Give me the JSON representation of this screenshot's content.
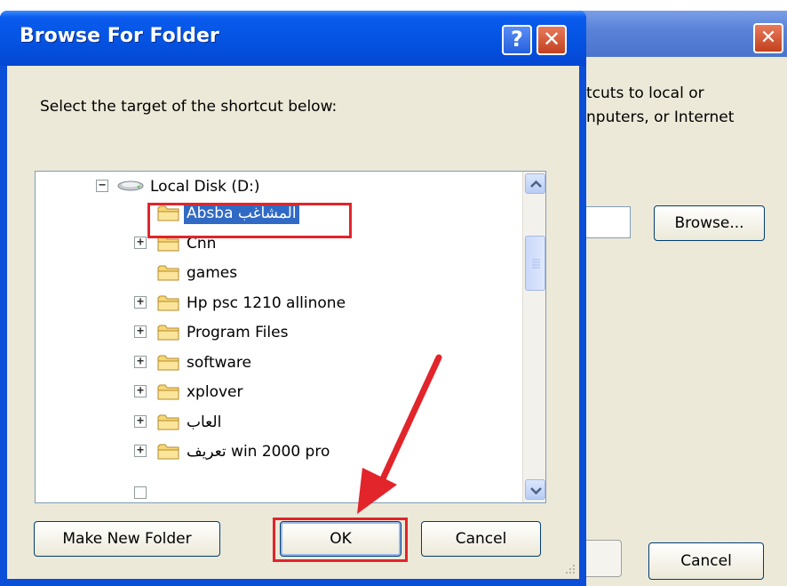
{
  "background_dialog": {
    "text_line1": "tcuts to local or",
    "text_line2": "nputers, or Internet",
    "browse_label": "Browse...",
    "cancel_label": "Cancel",
    "close_glyph": "✕"
  },
  "dialog": {
    "title": "Browse For Folder",
    "help_glyph": "?",
    "close_glyph": "✕",
    "prompt": "Select the target of the shortcut below:"
  },
  "tree": {
    "root": {
      "label": "Local Disk (D:)",
      "expander": "−",
      "icon": "drive-icon"
    },
    "items": [
      {
        "label": "Absba المشاغب",
        "expander": "",
        "selected": true
      },
      {
        "label": "Cnn",
        "expander": "+"
      },
      {
        "label": "games",
        "expander": ""
      },
      {
        "label": "Hp psc 1210 allinone",
        "expander": "+"
      },
      {
        "label": "Program Files",
        "expander": "+"
      },
      {
        "label": "software",
        "expander": "+"
      },
      {
        "label": "xplover",
        "expander": "+"
      },
      {
        "label": "العاب",
        "expander": "+"
      },
      {
        "label": "تعريف win 2000 pro",
        "expander": "+"
      }
    ]
  },
  "buttons": {
    "make_new_folder": "Make New Folder",
    "ok": "OK",
    "cancel": "Cancel"
  },
  "colors": {
    "titlebar": "#0554e3",
    "selection": "#316ac5",
    "annotation_red": "#e2242b",
    "dialog_face": "#ece9d8"
  }
}
